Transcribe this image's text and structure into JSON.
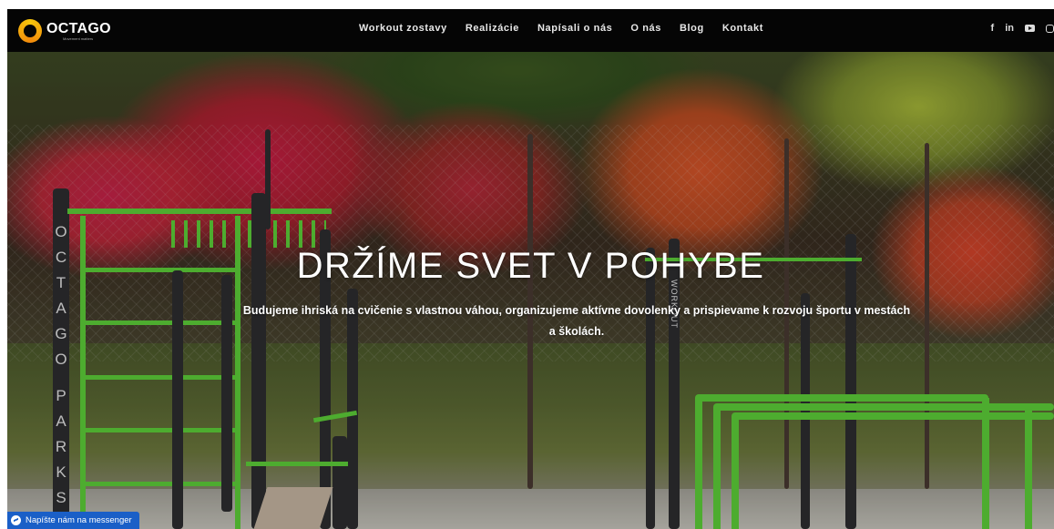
{
  "brand": {
    "name": "OCTAGO",
    "tagline": "Movement matters",
    "colors": {
      "ring": "#f5a50b",
      "accent_green": "#5fd23a",
      "nav_bg": "#050505",
      "messenger": "#1a5fc7"
    }
  },
  "nav": {
    "items": [
      "Workout zostavy",
      "Realizácie",
      "Napísali o nás",
      "O nás",
      "Blog",
      "Kontakt"
    ],
    "social": {
      "facebook": "f",
      "linkedin": "in",
      "youtube_icon": "youtube-icon",
      "instagram_icon": "instagram-icon"
    }
  },
  "hero": {
    "headline": "DRŽÍME SVET V POHYBE",
    "subtext": "Budujeme ihriská na cvičenie s vlastnou váhou, organizujeme aktívne dovolenky a prispievame k rozvoju športu v mestách a školách.",
    "pole_letters": [
      "O",
      "C",
      "T",
      "A",
      "G",
      "O",
      "",
      "P",
      "A",
      "R",
      "K",
      "S"
    ],
    "pole_label_2": "WORKOUT"
  },
  "messenger": {
    "label": "Napíšte nám na messenger",
    "icon": "messenger-icon"
  }
}
